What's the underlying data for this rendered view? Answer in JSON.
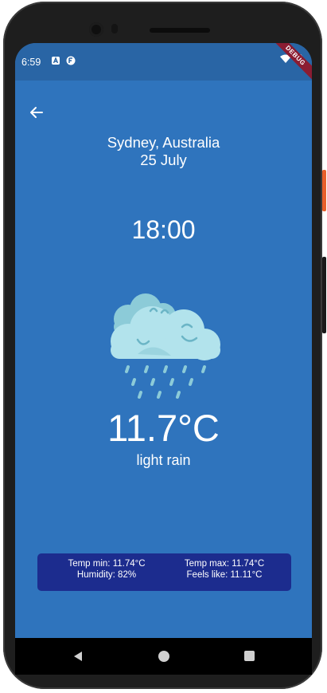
{
  "status_bar": {
    "time": "6:59",
    "debug_banner": "DEBUG"
  },
  "weather": {
    "location": "Sydney, Australia",
    "date": "25 July",
    "time": "18:00",
    "temperature": "11.7°C",
    "description": "light rain",
    "icon": "cloud-rain-icon"
  },
  "details": {
    "temp_min": "Temp min: 11.74°C",
    "temp_max": "Temp max: 11.74°C",
    "humidity": "Humidity: 82%",
    "feels_like": "Feels like: 11.11°C"
  },
  "colors": {
    "background": "#2f74bd",
    "status_bar": "#2965a5",
    "details_card": "#1c2c8e",
    "debug_banner": "#8b1c32"
  }
}
